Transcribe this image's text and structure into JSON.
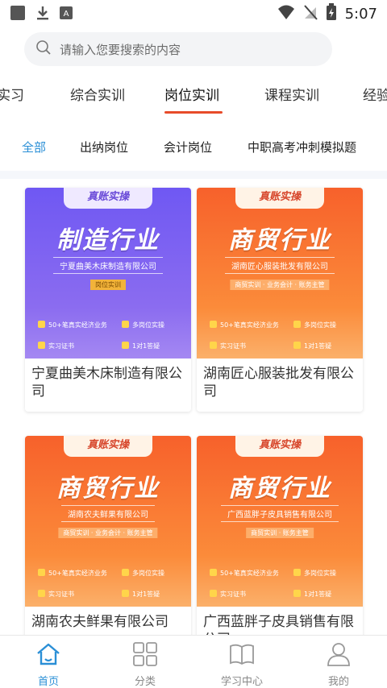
{
  "status": {
    "time": "5:07"
  },
  "search": {
    "placeholder": "请输入您要搜索的内容"
  },
  "tabs": [
    {
      "label": "实习"
    },
    {
      "label": "综合实训"
    },
    {
      "label": "岗位实训"
    },
    {
      "label": "课程实训"
    },
    {
      "label": "经验"
    }
  ],
  "subtabs": [
    {
      "label": "全部"
    },
    {
      "label": "出纳岗位"
    },
    {
      "label": "会计岗位"
    },
    {
      "label": "中职高考冲刺模拟题"
    }
  ],
  "colors": {
    "accent": "#2a8fd6",
    "tab_underline": "#e74b2a"
  },
  "cards": [
    {
      "tag": "真账实操",
      "industry": "制造行业",
      "company": "宁夏曲美木床制造有限公司",
      "sub": "岗位实训",
      "features": [
        "50+笔真实经济业务",
        "多岗位实操",
        "实习证书",
        "1对1答疑"
      ],
      "title": "宁夏曲美木床制造有限公司"
    },
    {
      "tag": "真账实操",
      "industry": "商贸行业",
      "company": "湖南匠心服装批发有限公司",
      "sub": "商贸实训 · 业务会计 · 账务主管",
      "features": [
        "50+笔真实经济业务",
        "多岗位实操",
        "实习证书",
        "1对1答疑"
      ],
      "title": "湖南匠心服装批发有限公司"
    },
    {
      "tag": "真账实操",
      "industry": "商贸行业",
      "company": "湖南农夫鲜果有限公司",
      "sub": "商贸实训 · 业务会计 · 账务主管",
      "features": [
        "50+笔真实经济业务",
        "多岗位实操",
        "实习证书",
        "1对1答疑"
      ],
      "title": "湖南农夫鲜果有限公司"
    },
    {
      "tag": "真账实操",
      "industry": "商贸行业",
      "company": "广西蓝胖子皮具销售有限公司",
      "sub": "商贸实训 · 账务主管",
      "features": [
        "50+笔真实经济业务",
        "多岗位实操",
        "实习证书",
        "1对1答疑"
      ],
      "title": "广西蓝胖子皮具销售有限公司"
    }
  ],
  "nav": [
    {
      "label": "首页",
      "icon": "home-icon"
    },
    {
      "label": "分类",
      "icon": "grid-icon"
    },
    {
      "label": "学习中心",
      "icon": "book-icon"
    },
    {
      "label": "我的",
      "icon": "user-icon"
    }
  ]
}
